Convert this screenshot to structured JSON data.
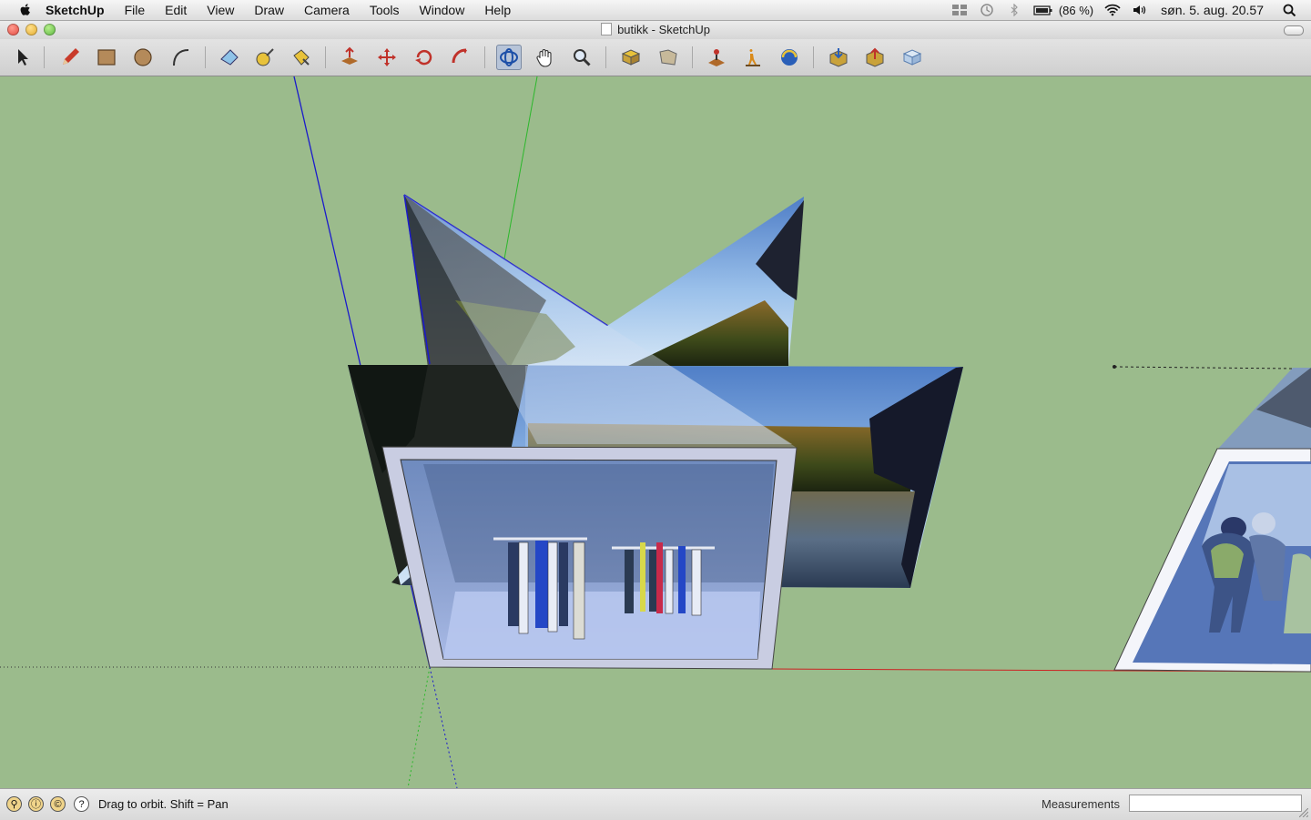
{
  "menubar": {
    "app_name": "SketchUp",
    "menus": [
      "File",
      "Edit",
      "View",
      "Draw",
      "Camera",
      "Tools",
      "Window",
      "Help"
    ],
    "battery": "(86 %)",
    "clock": "søn. 5. aug.  20.57"
  },
  "window": {
    "title": "butikk - SketchUp"
  },
  "toolbar": {
    "tools": [
      {
        "name": "select-tool",
        "icon": "arrow-cursor-icon"
      },
      {
        "name": "pencil-tool",
        "icon": "pencil-icon"
      },
      {
        "name": "rectangle-tool",
        "icon": "rectangle-icon"
      },
      {
        "name": "circle-tool",
        "icon": "circle-icon"
      },
      {
        "name": "arc-tool",
        "icon": "arc-icon"
      },
      {
        "name": "eraser-tool",
        "icon": "eraser-icon"
      },
      {
        "name": "tape-measure-tool",
        "icon": "tape-measure-icon"
      },
      {
        "name": "paint-bucket-tool",
        "icon": "paint-bucket-icon"
      },
      {
        "name": "push-pull-tool",
        "icon": "push-pull-icon"
      },
      {
        "name": "move-tool",
        "icon": "move-icon"
      },
      {
        "name": "rotate-tool",
        "icon": "rotate-icon"
      },
      {
        "name": "follow-me-tool",
        "icon": "follow-me-icon"
      },
      {
        "name": "orbit-tool",
        "icon": "orbit-icon",
        "active": true
      },
      {
        "name": "pan-tool",
        "icon": "hand-icon"
      },
      {
        "name": "zoom-tool",
        "icon": "magnifier-icon"
      },
      {
        "name": "zoom-extents-tool",
        "icon": "zoom-extents-icon"
      },
      {
        "name": "previous-view-tool",
        "icon": "previous-view-icon"
      },
      {
        "name": "position-camera-tool",
        "icon": "position-camera-icon"
      },
      {
        "name": "walk-tool",
        "icon": "walk-icon"
      },
      {
        "name": "look-around-tool",
        "icon": "look-around-icon"
      },
      {
        "name": "get-models-tool",
        "icon": "get-models-icon"
      },
      {
        "name": "share-model-tool",
        "icon": "share-model-icon"
      },
      {
        "name": "send-to-layout-tool",
        "icon": "send-to-layout-icon"
      }
    ]
  },
  "statusbar": {
    "hint": "Drag to orbit.  Shift = Pan",
    "measurements_label": "Measurements",
    "measurements_value": ""
  },
  "colors": {
    "ground": "#9bbb8c",
    "axis_blue": "#1a1acc",
    "axis_green": "#2bb82b",
    "axis_red": "#cc2222"
  }
}
